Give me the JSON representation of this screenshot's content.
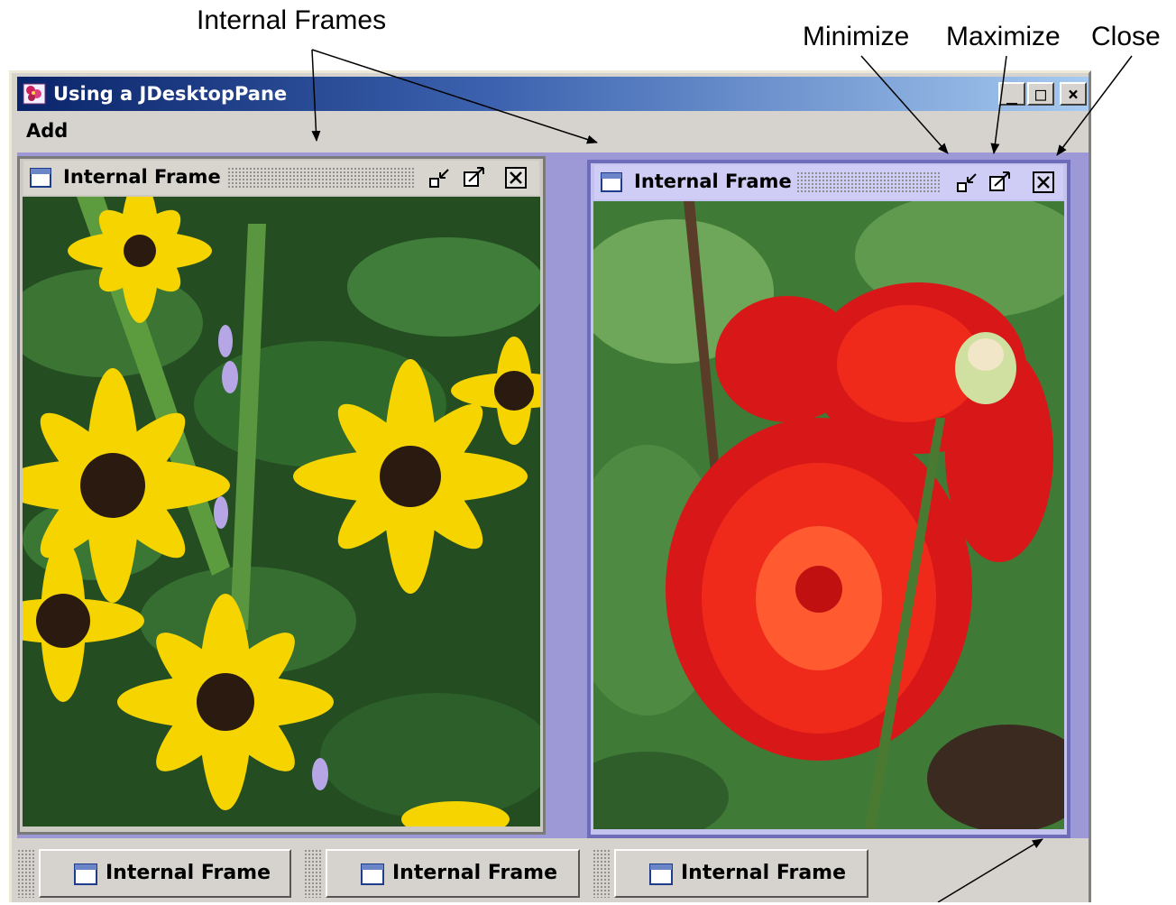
{
  "callouts": {
    "internal_frames": "Internal Frames",
    "minimize": "Minimize",
    "maximize": "Maximize",
    "close": "Close"
  },
  "window": {
    "title": "Using a JDesktopPane",
    "minimize_glyph": "_",
    "maximize_glyph": "□",
    "close_glyph": "×"
  },
  "menu": {
    "add": "Add"
  },
  "frames": [
    {
      "title": "Internal Frame",
      "image": "yellow black-eyed susan flowers"
    },
    {
      "title": "Internal Frame",
      "image": "red dahlia flowers"
    }
  ],
  "minimized_frames": [
    {
      "title": "Internal Frame"
    },
    {
      "title": "Internal Frame"
    },
    {
      "title": "Internal Frame"
    }
  ],
  "colors": {
    "desktop": "#9c99d6",
    "titlebar_start": "#0a246a",
    "titlebar_end": "#a6caf0",
    "active_frame_border": "#6e6cb8"
  },
  "icons": [
    "app-flower-icon",
    "frame-window-icon",
    "iconify-icon",
    "maximize-icon",
    "close-icon"
  ]
}
